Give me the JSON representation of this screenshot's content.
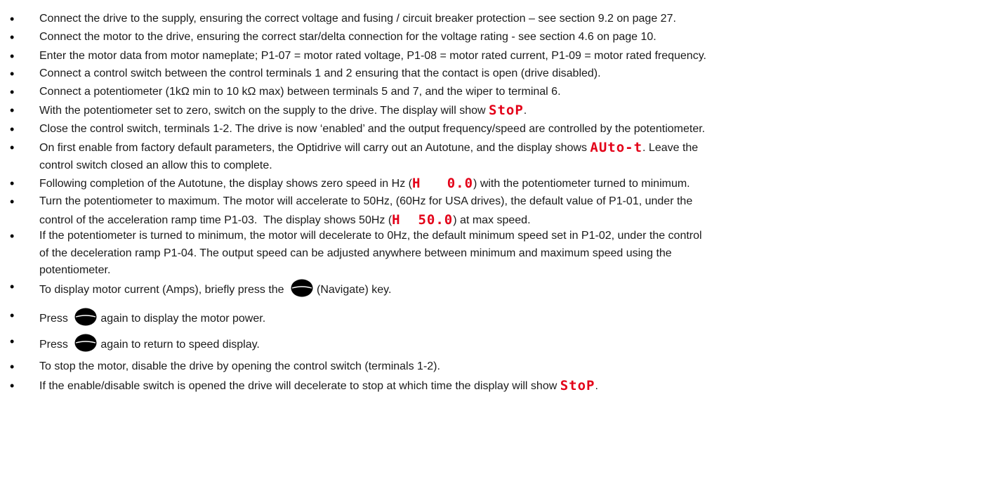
{
  "bullet_glyph": "•",
  "icons": {
    "navigate_key": "navigate-key-icon",
    "lcd_color": "#e30018"
  },
  "items": [
    {
      "lines": [
        [
          {
            "t": "Connect the drive to the supply, ensuring the correct voltage and fusing / circuit breaker protection – see section 9.2 on page 27."
          }
        ]
      ]
    },
    {
      "lines": [
        [
          {
            "t": "Connect the motor to the drive, ensuring the correct star/delta connection for the voltage rating - see section 4.6 on page 10."
          }
        ]
      ]
    },
    {
      "lines": [
        [
          {
            "t": "Enter the motor data from motor nameplate; P1-07 = motor rated voltage, P1-08 = motor rated current, P1-09 = motor rated frequency."
          }
        ]
      ]
    },
    {
      "lines": [
        [
          {
            "t": "Connect a control switch between the control terminals 1 and 2 ensuring that the contact is open (drive disabled)."
          }
        ]
      ]
    },
    {
      "lines": [
        [
          {
            "t": "Connect a potentiometer (1kΩ min to 10 kΩ max) between terminals 5 and 7, and the wiper to terminal 6."
          }
        ]
      ]
    },
    {
      "lines": [
        [
          {
            "t": "With the potentiometer set to zero, switch on the supply to the drive. The display will show "
          },
          {
            "lcd": "StoP"
          },
          {
            "t": "."
          }
        ]
      ]
    },
    {
      "lines": [
        [
          {
            "t": "Close the control switch, terminals 1-2. The drive is now ‘enabled’ and the output frequency/speed are controlled by the potentiometer."
          }
        ]
      ]
    },
    {
      "lines": [
        [
          {
            "t": "On first enable from factory default parameters, the Optidrive will carry out an Autotune, and the display shows "
          },
          {
            "lcd": "AUto-t"
          },
          {
            "t": ". Leave the"
          }
        ],
        [
          {
            "t": "control switch closed an allow this to complete."
          }
        ]
      ]
    },
    {
      "lines": [
        [
          {
            "t": "Following completion of the Autotune, the display shows zero speed in Hz ("
          },
          {
            "lcd": "H   0.0"
          },
          {
            "t": ") with the potentiometer turned to minimum."
          }
        ]
      ]
    },
    {
      "lines": [
        [
          {
            "t": "Turn the potentiometer to maximum. The motor will accelerate to 50Hz, (60Hz for USA drives), the default value of P1-01, under the"
          }
        ],
        [
          {
            "t": "control of the acceleration ramp time P1-03.  The display shows 50Hz ("
          },
          {
            "lcd": "H  50.0"
          },
          {
            "t": ") at max speed."
          }
        ]
      ]
    },
    {
      "lines": [
        [
          {
            "t": "If the potentiometer is turned to minimum, the motor will decelerate to 0Hz, the default minimum speed set in P1-02, under the control"
          }
        ],
        [
          {
            "t": "of the deceleration ramp P1-04. The output speed can be adjusted anywhere between minimum and maximum speed using the"
          }
        ],
        [
          {
            "t": "potentiometer."
          }
        ]
      ]
    },
    {
      "lines": [
        [
          {
            "t": "To display motor current (Amps), briefly press the "
          },
          {
            "key": "navigate"
          },
          {
            "t": "(Navigate) key."
          }
        ]
      ]
    },
    {
      "lines": [
        [
          {
            "t": "Press "
          },
          {
            "key": "navigate"
          },
          {
            "t": "again to display the motor power."
          }
        ]
      ]
    },
    {
      "lines": [
        [
          {
            "t": "Press "
          },
          {
            "key": "navigate"
          },
          {
            "t": "again to return to speed display."
          }
        ]
      ]
    },
    {
      "lines": [
        [
          {
            "t": "To stop the motor, disable the drive by opening the control switch (terminals 1-2)."
          }
        ]
      ]
    },
    {
      "lines": [
        [
          {
            "t": "If the enable/disable switch is opened the drive will decelerate to stop at which time the display will show "
          },
          {
            "lcd": "StoP"
          },
          {
            "t": "."
          }
        ]
      ]
    }
  ]
}
